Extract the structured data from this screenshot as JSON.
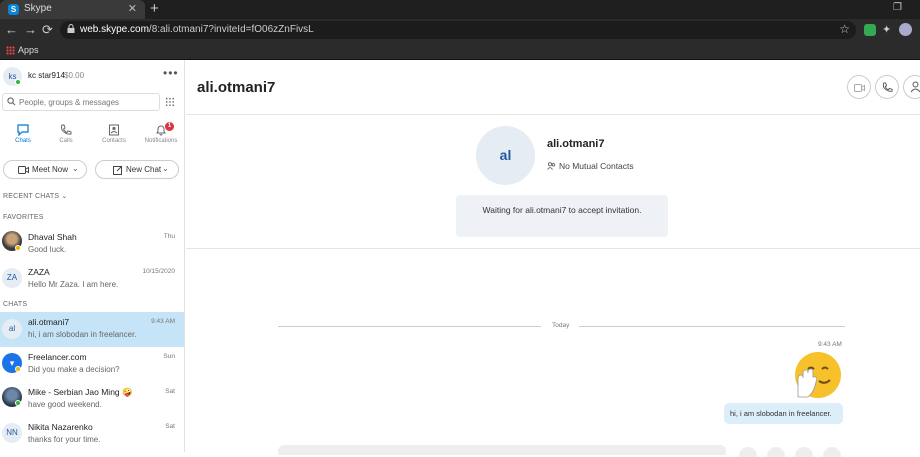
{
  "browser": {
    "tab_title": "Skype",
    "tab_close": "✕",
    "new_tab": "+",
    "url_host": "web.skype.com",
    "url_path": "/8:ali.otmani7?inviteId=fO06zZnFivsL",
    "bookmarks": {
      "apps_label": "Apps"
    }
  },
  "profile": {
    "initials": "ks",
    "name": "kc star914",
    "credit": "$0.00",
    "more": "•••"
  },
  "search": {
    "placeholder": "People, groups & messages"
  },
  "nav": {
    "chats": "Chats",
    "calls": "Calls",
    "contacts": "Contacts",
    "notifications": "Notifications",
    "notifications_badge": "1"
  },
  "actions": {
    "meet_now": "Meet Now",
    "new_chat": "New Chat"
  },
  "sections": {
    "recent": "RECENT CHATS",
    "favorites": "FAVORITES",
    "chats": "CHATS"
  },
  "favorites": [
    {
      "name": "Dhaval Shah",
      "message": "Good luck.",
      "time": "Thu"
    },
    {
      "initials": "ZA",
      "name": "ZAZA",
      "message": "Hello Mr Zaza. I am here.",
      "time": "10/15/2020"
    }
  ],
  "chats": [
    {
      "initials": "al",
      "name": "ali.otmani7",
      "message": "hi, i am slobodan in freelancer.",
      "time": "9:43 AM",
      "selected": true
    },
    {
      "name": "Freelancer.com",
      "message": "Did you make a decision?",
      "time": "Sun"
    },
    {
      "name": "Mike - Serbian Jao Ming 🤪",
      "message": "have good weekend.",
      "time": "Sat"
    },
    {
      "initials": "NN",
      "name": "Nikita Nazarenko",
      "message": "thanks for your time.",
      "time": "Sat"
    }
  ],
  "conversation": {
    "title": "ali.otmani7",
    "avatar_initials": "al",
    "contact_name": "ali.otmani7",
    "mutual": "No Mutual Contacts",
    "waiting": "Waiting for ali.otmani7 to accept invitation.",
    "divider": "Today",
    "message_time": "9:43 AM",
    "message_text": "hi, i am slobodan in freelancer."
  },
  "colors": {
    "accent": "#0078d4",
    "selected_row": "#c6e4f7",
    "bubble": "#dbeefa",
    "badge": "#d9363e"
  }
}
